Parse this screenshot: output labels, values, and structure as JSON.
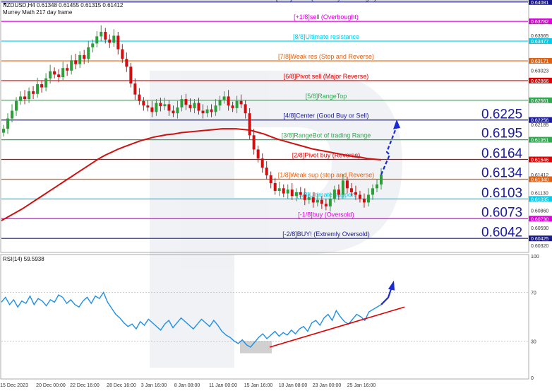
{
  "header": {
    "symbol_line": "NZDUSD,H4  0.61348 0.61455 0.61315 0.61412",
    "indicator_name": "Murrey Math 217 day frame"
  },
  "rsi_header": "RSI(14) 59.5938",
  "chart_data": {
    "type": "line",
    "price": {
      "ylim": [
        0.6023,
        0.6409
      ],
      "price_ticks": [
        "0.64081",
        "0.63782",
        "0.63565",
        "0.63477",
        "0.63171",
        "0.63023",
        "0.62866",
        "0.62561",
        "0.62256",
        "0.62185",
        "0.61951",
        "0.61646",
        "0.61412",
        "0.61340",
        "0.61130",
        "0.61035",
        "0.60860",
        "0.60730",
        "0.60590",
        "0.60425",
        "0.60320"
      ],
      "murrey_levels": [
        {
          "label": "[+2/8]SELL! (extremely overbought)",
          "price": 0.64081,
          "color": "#1a1a8c",
          "tag": "0.64081"
        },
        {
          "label": "[+1/8]sell (Overbought)",
          "price": 0.63782,
          "color": "#e000e0",
          "tag": "0.63782"
        },
        {
          "label": "[8/8]Ultimate resistance",
          "price": 0.63477,
          "color": "#00ccee",
          "tag": "0.63477"
        },
        {
          "label": "[7/8]Weak res (Stop and Reverse)",
          "price": 0.63171,
          "color": "#e06010",
          "tag": "0.63171"
        },
        {
          "label": "[6/8]Pivot sell (Major Reverse)",
          "price": 0.62866,
          "color": "#e00000",
          "tag": "0.62866"
        },
        {
          "label": "[5/8]RangeTop",
          "price": 0.62561,
          "color": "#2fa84f",
          "tag": "0.62561"
        },
        {
          "label": "[4/8]Center (Good Buy or Sell)",
          "price": 0.62256,
          "color": "#1a1aa0",
          "tag": "0.62256"
        },
        {
          "label": "[3/8]RangeBot of trading Range",
          "price": 0.61951,
          "color": "#2fa84f",
          "tag": "0.61951"
        },
        {
          "label": "[2/8]Pivot buy (Reverse)",
          "price": 0.61646,
          "color": "#e00000",
          "tag": "0.61646"
        },
        {
          "label": "[1/8]Weak sup (stop and Reverse)",
          "price": 0.6134,
          "color": "#e06010",
          "tag": "0.61340"
        },
        {
          "label": "[0/8]Ultimate support",
          "price": 0.61035,
          "color": "#00ccee",
          "tag": "0.61035"
        },
        {
          "label": "[-1/8]buy (Oversold)",
          "price": 0.6073,
          "color": "#e000e0",
          "tag": "0.60730"
        },
        {
          "label": "[-2/8]BUY! (Extremly Oversold)",
          "price": 0.60425,
          "color": "#1a1a8c",
          "tag": "0.60425"
        }
      ],
      "big_levels": [
        "0.6225",
        "0.6195",
        "0.6164",
        "0.6134",
        "0.6103",
        "0.6073",
        "0.6042"
      ],
      "current_price": 0.61412,
      "closes": [
        0.6212,
        0.6228,
        0.624,
        0.6255,
        0.6262,
        0.6258,
        0.627,
        0.6266,
        0.6281,
        0.6276,
        0.629,
        0.6301,
        0.6296,
        0.6292,
        0.6306,
        0.6302,
        0.6318,
        0.6312,
        0.6326,
        0.632,
        0.6338,
        0.6344,
        0.6355,
        0.6362,
        0.635,
        0.6345,
        0.6356,
        0.6335,
        0.632,
        0.6308,
        0.6282,
        0.6265,
        0.6255,
        0.6248,
        0.6245,
        0.6238,
        0.6252,
        0.6247,
        0.625,
        0.624,
        0.6236,
        0.6245,
        0.6258,
        0.6249,
        0.6244,
        0.6252,
        0.624,
        0.6236,
        0.6242,
        0.6238,
        0.6248,
        0.6257,
        0.6262,
        0.6248,
        0.6244,
        0.6255,
        0.625,
        0.6236,
        0.6202,
        0.618,
        0.6166,
        0.6152,
        0.614,
        0.6128,
        0.6116,
        0.612,
        0.6112,
        0.6118,
        0.6108,
        0.6114,
        0.611,
        0.6102,
        0.6106,
        0.6098,
        0.6102,
        0.6096,
        0.6092,
        0.6104,
        0.6118,
        0.611,
        0.6132,
        0.612,
        0.6114,
        0.611,
        0.6104,
        0.6098,
        0.611,
        0.612,
        0.6126,
        0.6141
      ],
      "ma217": [
        0.607,
        0.6076,
        0.6082,
        0.6088,
        0.6095,
        0.6102,
        0.6109,
        0.6116,
        0.6123,
        0.613,
        0.6137,
        0.6144,
        0.6151,
        0.6158,
        0.6165,
        0.6171,
        0.6176,
        0.6181,
        0.6185,
        0.6189,
        0.6193,
        0.6196,
        0.6199,
        0.6201,
        0.6203,
        0.6204,
        0.6206,
        0.6207,
        0.6208,
        0.6209,
        0.621,
        0.6211,
        0.6212,
        0.6212,
        0.6212,
        0.6211,
        0.621,
        0.6207,
        0.6204,
        0.62,
        0.6196,
        0.6193,
        0.619,
        0.6187,
        0.6184,
        0.6181,
        0.6179,
        0.6177,
        0.6175,
        0.6173,
        0.6171,
        0.6169,
        0.6168,
        0.6166,
        0.6165,
        0.6164
      ]
    },
    "rsi": {
      "ylim": [
        0,
        100
      ],
      "levels": [
        30,
        70
      ],
      "tick_labels": [
        "100",
        "70",
        "30",
        "0"
      ],
      "values": [
        62,
        66,
        60,
        64,
        58,
        63,
        61,
        67,
        60,
        65,
        63,
        59,
        64,
        62,
        68,
        66,
        61,
        64,
        60,
        58,
        63,
        66,
        61,
        67,
        65,
        70,
        62,
        57,
        52,
        49,
        45,
        42,
        44,
        40,
        46,
        43,
        48,
        45,
        42,
        39,
        44,
        47,
        41,
        45,
        49,
        46,
        43,
        40,
        44,
        48,
        45,
        42,
        47,
        43,
        38,
        35,
        33,
        30,
        28,
        31,
        27,
        25,
        29,
        33,
        36,
        32,
        35,
        38,
        34,
        37,
        35,
        39,
        36,
        40,
        42,
        38,
        45,
        47,
        43,
        49,
        52,
        47,
        55,
        50,
        46,
        44,
        48,
        52,
        50,
        47,
        54,
        56,
        58,
        60
      ]
    },
    "x_tick_labels": [
      "15 Dec 2023",
      "20 Dec 00:00",
      "22 Dec 16:00",
      "28 Dec 16:00",
      "3 Jan 16:00",
      "8 Jan 08:00",
      "11 Jan 00:00",
      "15 Jan 16:00",
      "18 Jan 08:00",
      "23 Jan 00:00",
      "25 Jan 16:00"
    ]
  }
}
